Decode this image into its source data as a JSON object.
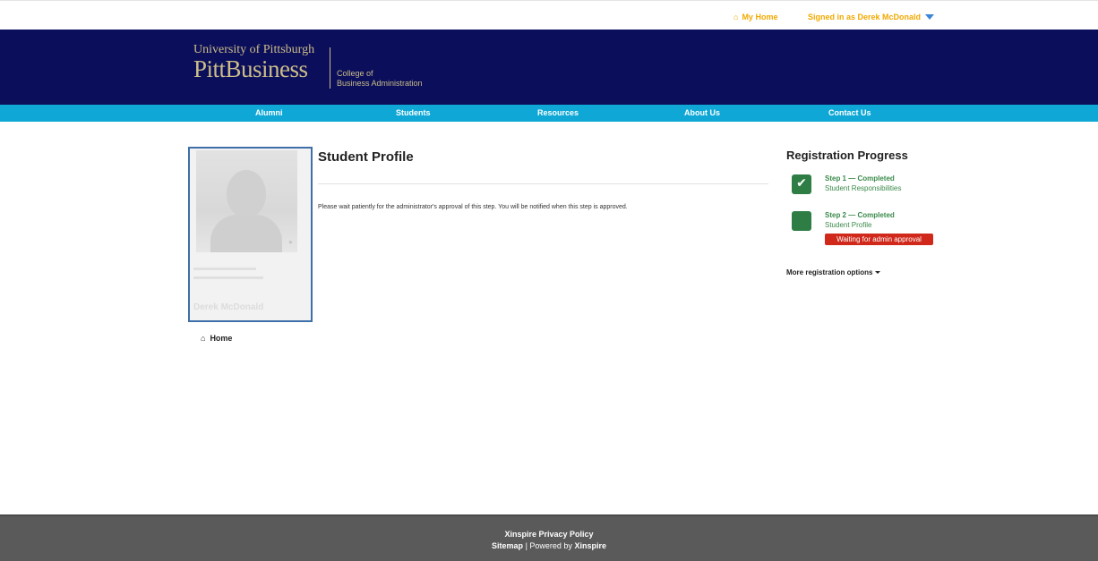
{
  "topbar": {
    "my_home": "My Home",
    "signed_in": "Signed in as Derek McDonald"
  },
  "header": {
    "university": "University of Pittsburgh",
    "brand": "PittBusiness",
    "college_line1": "College of",
    "college_line2": "Business Administration"
  },
  "nav": {
    "items": [
      {
        "label": "Alumni"
      },
      {
        "label": "Students"
      },
      {
        "label": "Resources"
      },
      {
        "label": "About Us"
      },
      {
        "label": "Contact Us"
      }
    ]
  },
  "profile": {
    "name": "Derek McDonald"
  },
  "sidebar": {
    "home_label": "Home"
  },
  "main": {
    "title": "Student Profile",
    "message": "Please wait patiently for the administrator's approval of this step. You will be notified when this step is approved."
  },
  "registration": {
    "title": "Registration Progress",
    "steps": [
      {
        "title": "Step 1 — Completed",
        "subtitle": "Student Responsibilities"
      },
      {
        "title": "Step 2 — Completed",
        "subtitle": "Student Profile",
        "badge": "Waiting for admin approval"
      }
    ],
    "more_options": "More registration options"
  },
  "footer": {
    "privacy": "Xinspire Privacy Policy",
    "sitemap": "Sitemap",
    "separator": " | Powered by ",
    "powered_brand": "Xinspire"
  },
  "colors": {
    "banner": "#0b0e5a",
    "nav": "#0fa8d6",
    "accent_gold": "#f2a900",
    "step_green": "#2e7d45",
    "badge_red": "#d0281a",
    "footer": "#5a5a5a"
  }
}
